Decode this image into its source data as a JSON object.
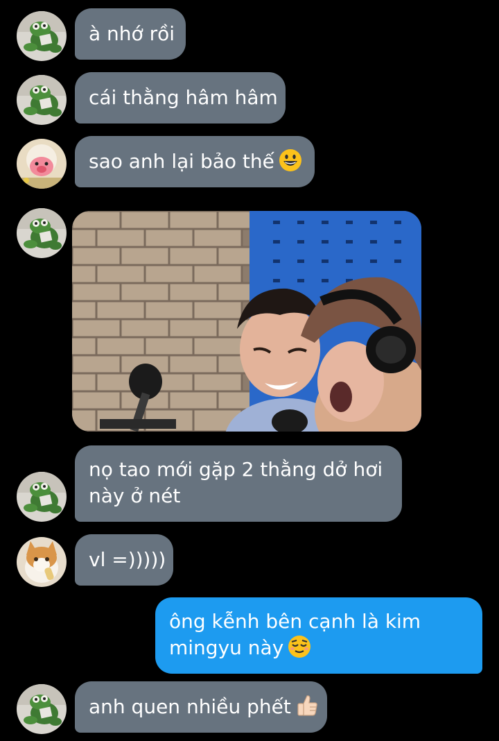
{
  "colors": {
    "background": "#000000",
    "incoming_bubble": "#67737f",
    "outgoing_bubble": "#1d9bf0",
    "text": "#ffffff"
  },
  "messages": [
    {
      "sender": "frog-plush-avatar",
      "text": "à nhớ rồi"
    },
    {
      "sender": "frog-plush-avatar",
      "text": "cái thằng hâm hâm"
    },
    {
      "sender": "pink-plush-avatar",
      "text": "sao anh lại bảo thế",
      "emoji": "grinning-face-icon"
    },
    {
      "sender": "frog-plush-avatar",
      "image": "photo-two-men-laughing-at-microphone"
    },
    {
      "sender": "frog-plush-avatar",
      "lines": [
        "nọ tao mới gặp 2 thằng dở hơi",
        "này ở nét"
      ]
    },
    {
      "sender": "cat-avatar",
      "text": "vl =)))))"
    },
    {
      "sender": "me",
      "lines": [
        "ông kễnh bên cạnh là kim",
        "mingyu này"
      ],
      "emoji": "relieved-face-icon"
    },
    {
      "sender": "frog-plush-avatar",
      "text": "anh quen nhiều phết",
      "emoji": "thumbs-up-icon"
    }
  ]
}
